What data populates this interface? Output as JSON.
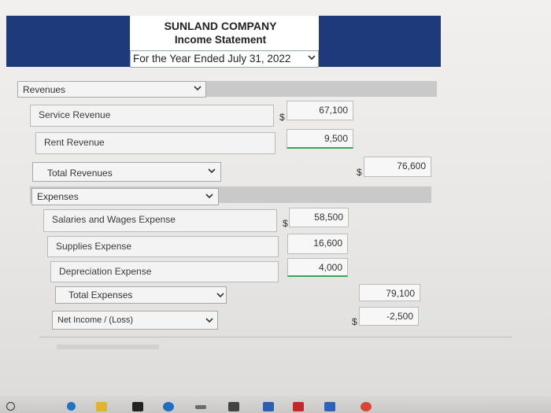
{
  "header": {
    "company": "SUNLAND COMPANY",
    "title": "Income Statement",
    "period": "For the Year Ended July 31, 2022"
  },
  "revenues": {
    "heading": "Revenues",
    "items": [
      {
        "label": "Service Revenue",
        "currency": "$",
        "amount": "67,100"
      },
      {
        "label": "Rent Revenue",
        "amount": "9,500"
      }
    ],
    "total_label": "Total Revenues",
    "total_currency": "$",
    "total_amount": "76,600"
  },
  "expenses": {
    "heading": "Expenses",
    "items": [
      {
        "label": "Salaries and Wages Expense",
        "currency": "$",
        "amount": "58,500"
      },
      {
        "label": "Supplies Expense",
        "amount": "16,600"
      },
      {
        "label": "Depreciation Expense",
        "amount": "4,000"
      }
    ],
    "total_label": "Total Expenses",
    "total_amount": "79,100"
  },
  "net": {
    "label": "Net Income / (Loss)",
    "currency": "$",
    "amount": "-2,500"
  },
  "taskbar": {
    "icons": [
      "start-icon",
      "search-icon",
      "task-view-icon",
      "file-explorer-icon",
      "store-icon",
      "edge-icon",
      "mail-icon",
      "calculator-icon",
      "word-icon",
      "chrome-icon"
    ]
  },
  "colors": {
    "header_band": "#1f3a7a",
    "section_band": "#c9c9c9",
    "total_underline": "#3aa35a"
  }
}
